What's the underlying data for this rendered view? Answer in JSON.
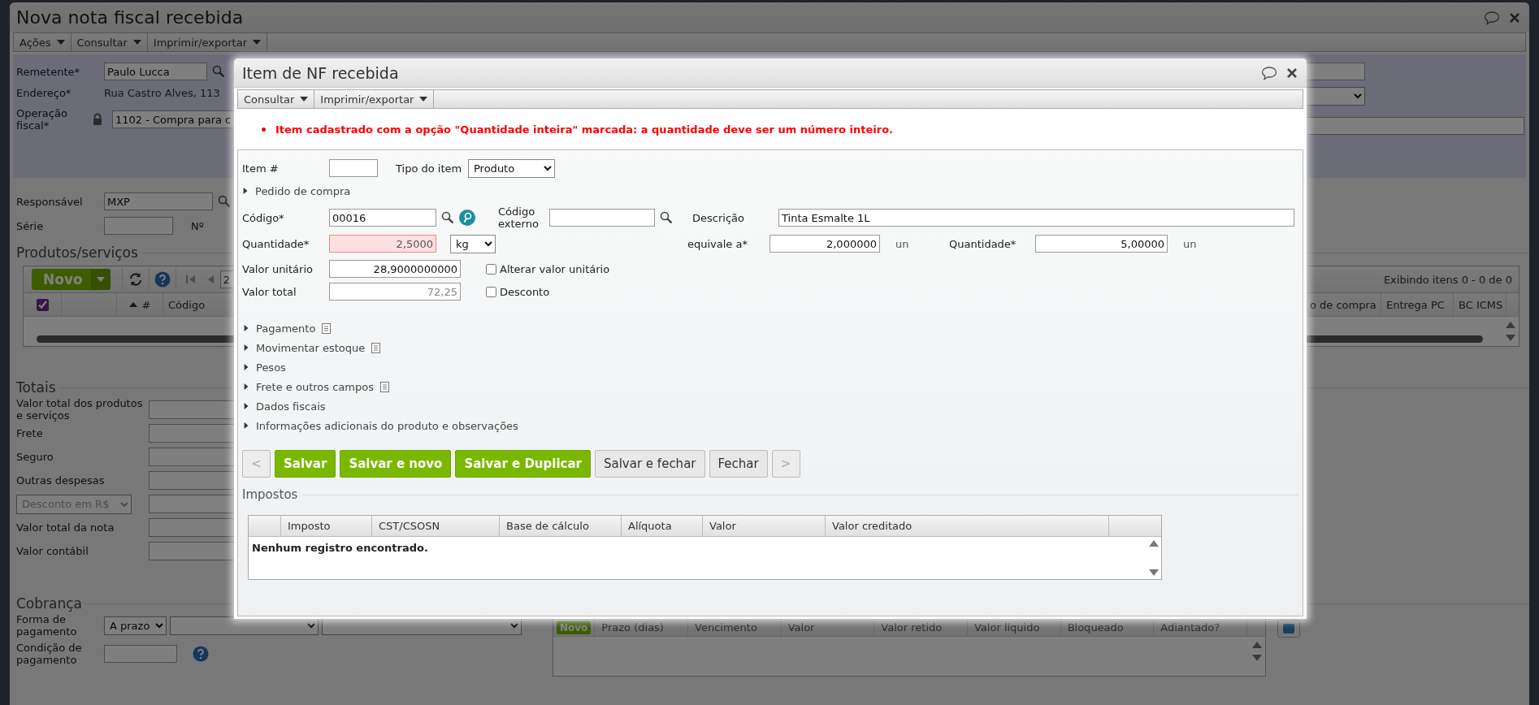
{
  "window": {
    "title": "Nova nota fiscal recebida"
  },
  "menu": [
    {
      "label": "Ações"
    },
    {
      "label": "Consultar"
    },
    {
      "label": "Imprimir/exportar"
    }
  ],
  "header_fields": [
    {
      "label": "Remetente*",
      "value": "Paulo Lucca",
      "kind": "lookup"
    },
    {
      "label": "Endereço*",
      "value": "Rua Castro Alves, 113",
      "kind": "text"
    },
    {
      "label": "Operação fiscal*",
      "value": "1102 - Compra para c",
      "kind": "locked"
    }
  ],
  "fields": [
    {
      "label": "Responsável",
      "value": "MXP",
      "kind": "lookup"
    },
    {
      "label": "Série",
      "kind": "numbered",
      "number_label": "Nº"
    }
  ],
  "products": {
    "title": "Produtos/serviços",
    "new_button": "Novo",
    "page": "2",
    "summary": "Exibindo itens 0 - 0 de 0",
    "select_all": true,
    "columns": [
      "#",
      "Código",
      "o de compra",
      "Entrega PC",
      "BC ICMS"
    ]
  },
  "totals": {
    "title": "Totais",
    "rows": [
      {
        "label": "Valor total dos produtos e serviços",
        "kind": "input"
      },
      {
        "label": "Frete",
        "kind": "input"
      },
      {
        "label": "Seguro",
        "kind": "input"
      },
      {
        "label": "Outras despesas",
        "kind": "input"
      },
      {
        "label": "Desconto em R$",
        "kind": "select",
        "disabled": true
      },
      {
        "label": "Valor total da nota",
        "kind": "input"
      },
      {
        "label": "Valor contábil",
        "kind": "input"
      }
    ]
  },
  "billing": {
    "title": "Cobrança",
    "payment_form": {
      "label": "Forma de pagamento",
      "value": "A prazo"
    },
    "payment_condition": {
      "label": "Condição de pagamento"
    },
    "installments": {
      "new_button": "Novo",
      "columns": [
        "Prazo (dias)",
        "Vencimento",
        "Valor",
        "Valor retido",
        "Valor líquido",
        "Bloqueado",
        "Adiantado?"
      ]
    }
  },
  "dialog": {
    "title": "Item de NF recebida",
    "menu": [
      {
        "label": "Consultar"
      },
      {
        "label": "Imprimir/exportar"
      }
    ],
    "errors": [
      "Item cadastrado com a opção \"Quantidade inteira\" marcada: a quantidade deve ser um número inteiro."
    ],
    "item_number": {
      "label": "Item #"
    },
    "item_type": {
      "label": "Tipo do item",
      "value": "Produto"
    },
    "purchase_order": {
      "label": "Pedido de compra",
      "expanded": false
    },
    "code": {
      "label": "Código*",
      "value": "00016"
    },
    "external_code": {
      "label": "Código externo"
    },
    "description": {
      "label": "Descrição",
      "value": "Tinta Esmalte 1L"
    },
    "quantity": {
      "label": "Quantidade*",
      "value": "2,5000",
      "invalid": true,
      "unit": "kg"
    },
    "equivalent": {
      "label": "equivale a*",
      "value": "2,000000",
      "unit": "un"
    },
    "converted_quantity": {
      "label": "Quantidade*",
      "value": "5,00000",
      "unit": "un"
    },
    "unit_price": {
      "label": "Valor unitário",
      "value": "28,9000000000"
    },
    "alter_unit_price": {
      "label": "Alterar valor unitário",
      "checked": false
    },
    "total": {
      "label": "Valor total",
      "value": "72,25",
      "readonly": true
    },
    "discount": {
      "label": "Desconto",
      "checked": false
    },
    "sections": [
      {
        "label": "Pagamento",
        "expanded": false,
        "has_notes": true
      },
      {
        "label": "Movimentar estoque",
        "expanded": false,
        "has_notes": true
      },
      {
        "label": "Pesos",
        "expanded": false,
        "has_notes": false
      },
      {
        "label": "Frete e outros campos",
        "expanded": false,
        "has_notes": true
      },
      {
        "label": "Dados fiscais",
        "expanded": false,
        "has_notes": false
      },
      {
        "label": "Informações adicionais do produto e observações",
        "expanded": false,
        "has_notes": false
      }
    ],
    "buttons": [
      {
        "label": "<",
        "kind": "nav",
        "disabled": true
      },
      {
        "label": "Salvar",
        "kind": "primary",
        "disabled": false
      },
      {
        "label": "Salvar e novo",
        "kind": "primary",
        "disabled": false
      },
      {
        "label": "Salvar e Duplicar",
        "kind": "primary",
        "disabled": false
      },
      {
        "label": "Salvar e fechar",
        "kind": "secondary",
        "disabled": false
      },
      {
        "label": "Fechar",
        "kind": "secondary",
        "disabled": false
      },
      {
        "label": ">",
        "kind": "nav",
        "disabled": true
      }
    ],
    "taxes": {
      "title": "Impostos",
      "columns": [
        "Imposto",
        "CST/CSOSN",
        "Base de cálculo",
        "Alíquota",
        "Valor",
        "Valor creditado"
      ],
      "empty_message": "Nenhum registro encontrado."
    }
  }
}
